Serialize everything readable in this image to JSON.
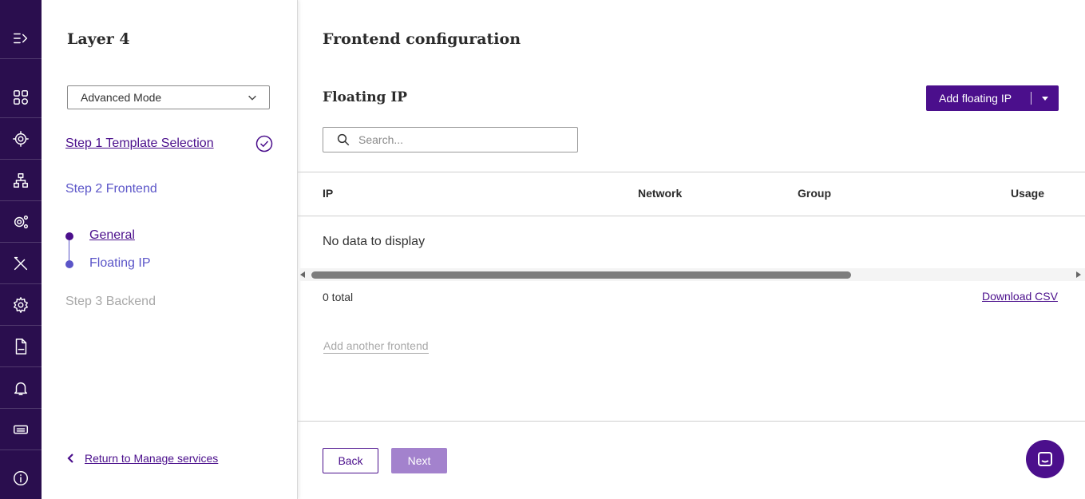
{
  "rail": {
    "items": [
      {
        "icon": "expand-menu-icon"
      },
      {
        "icon": "dashboard-icon"
      },
      {
        "icon": "hub-gear-icon"
      },
      {
        "icon": "network-icon"
      },
      {
        "icon": "multi-gear-icon"
      },
      {
        "icon": "tools-icon"
      },
      {
        "icon": "settings-icon"
      },
      {
        "icon": "log-file-icon"
      },
      {
        "icon": "bell-icon"
      },
      {
        "icon": "ticket-icon"
      },
      {
        "icon": "info-icon"
      }
    ]
  },
  "left": {
    "title": "Layer 4",
    "mode_select": "Advanced Mode",
    "step1": "Step 1 Template Selection",
    "step2": "Step 2 Frontend",
    "sub1": "General",
    "sub2": "Floating IP",
    "step3": "Step 3 Backend",
    "return_link": "Return to Manage services"
  },
  "main": {
    "title": "Frontend configuration",
    "section_title": "Floating IP",
    "add_button": "Add floating IP",
    "search_placeholder": "Search...",
    "columns": [
      "IP",
      "Network",
      "Group",
      "Usage"
    ],
    "empty_text": "No data to display",
    "total": "0 total",
    "download_csv": "Download CSV",
    "add_another": "Add another frontend",
    "back": "Back",
    "next": "Next"
  },
  "colors": {
    "rail_bg": "#2a0e4e",
    "primary": "#4b0f8c",
    "step_active": "#5b55c8",
    "disabled": "#a8a8a8",
    "next_disabled_bg": "#a382cd"
  }
}
